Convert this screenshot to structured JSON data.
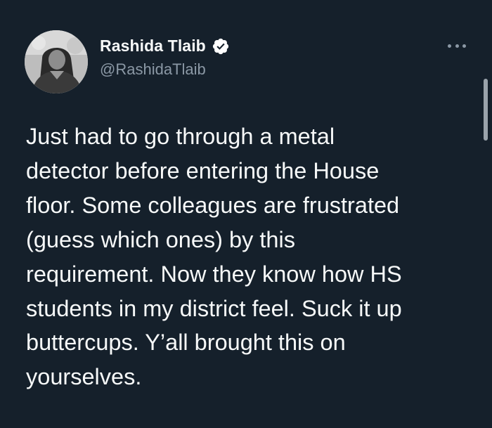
{
  "tweet": {
    "author": {
      "display_name": "Rashida Tlaib",
      "handle": "@RashidaTlaib",
      "verified": true,
      "avatar_icon": "profile-photo"
    },
    "more_icon": "ellipsis-icon",
    "text": "Just had to go through a metal\ndetector before entering the House\nfloor. Some colleagues are frustrated\n(guess which ones) by this\nrequirement. Now they know how HS\nstudents in my district feel. Suck it up\nbuttercups. Y’all brought this on\nyourselves."
  },
  "colors": {
    "background": "#15202b",
    "text_primary": "#f7f9f9",
    "text_secondary": "#8b98a5",
    "verified_badge": "#ffffff"
  }
}
